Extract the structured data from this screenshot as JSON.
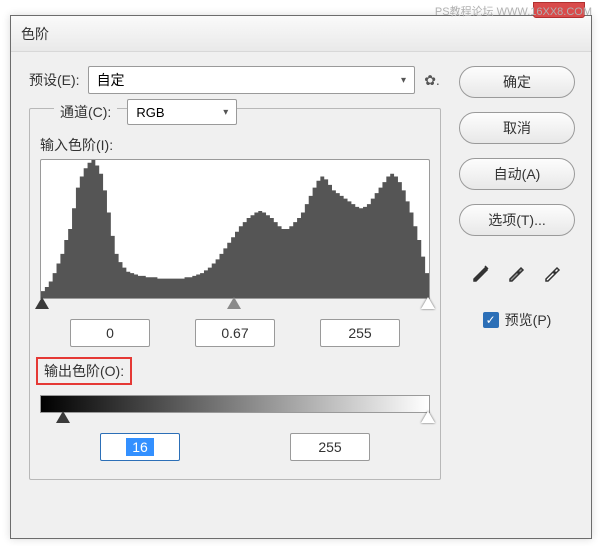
{
  "watermark": "PS教程论坛    WWW.16XX8.COM",
  "window": {
    "title": "色阶"
  },
  "preset": {
    "label": "预设(E):",
    "value": "自定"
  },
  "channel": {
    "label": "通道(C):",
    "value": "RGB"
  },
  "input_levels": {
    "label": "输入色阶(I):",
    "shadow": "0",
    "mid": "0.67",
    "highlight": "255"
  },
  "output_levels": {
    "label": "输出色阶(O):",
    "low": "16",
    "high": "255"
  },
  "buttons": {
    "ok": "确定",
    "cancel": "取消",
    "auto": "自动(A)",
    "options": "选项(T)..."
  },
  "preview": {
    "label": "预览(P)",
    "checked": true
  },
  "chart_data": {
    "type": "histogram",
    "title": "输入色阶",
    "xlabel": "",
    "ylabel": "",
    "xlim": [
      0,
      255
    ],
    "ylim": [
      0,
      100
    ],
    "values": [
      5,
      8,
      12,
      18,
      25,
      32,
      42,
      50,
      65,
      80,
      88,
      94,
      98,
      100,
      96,
      90,
      78,
      62,
      45,
      32,
      26,
      22,
      19,
      18,
      17,
      16,
      16,
      15,
      15,
      15,
      14,
      14,
      14,
      14,
      14,
      14,
      14,
      15,
      15,
      16,
      17,
      18,
      20,
      22,
      25,
      28,
      32,
      36,
      40,
      44,
      48,
      52,
      55,
      58,
      60,
      62,
      63,
      62,
      60,
      58,
      55,
      52,
      50,
      50,
      52,
      55,
      58,
      62,
      68,
      74,
      80,
      85,
      88,
      86,
      82,
      78,
      76,
      74,
      72,
      70,
      68,
      66,
      65,
      66,
      68,
      72,
      76,
      80,
      84,
      88,
      90,
      88,
      84,
      78,
      70,
      62,
      52,
      42,
      30,
      18
    ]
  }
}
